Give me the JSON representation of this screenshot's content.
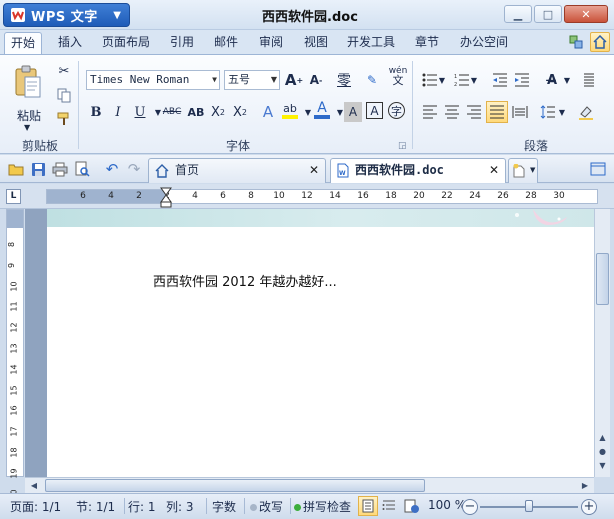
{
  "app": {
    "name": "WPS 文字",
    "document_title": "西西软件园.doc",
    "accent_color": "#2d6ac9"
  },
  "ribbon_tabs": [
    {
      "label": "开始",
      "active": true
    },
    {
      "label": "插入"
    },
    {
      "label": "页面布局"
    },
    {
      "label": "引用"
    },
    {
      "label": "邮件"
    },
    {
      "label": "审阅"
    },
    {
      "label": "视图"
    },
    {
      "label": "开发工具"
    },
    {
      "label": "章节"
    },
    {
      "label": "办公空间"
    }
  ],
  "clipboard": {
    "paste_label": "粘贴",
    "group_label": "剪贴板"
  },
  "font": {
    "family": "Times New Roman",
    "size": "五号",
    "group_label": "字体",
    "phonetic_sample": "wén"
  },
  "paragraph": {
    "group_label": "段落"
  },
  "doc_tabs": [
    {
      "label": "首页"
    },
    {
      "label": "西西软件园.doc",
      "active": true
    }
  ],
  "ruler": {
    "corner": "L",
    "h_ticks": [
      "6",
      "4",
      "2",
      "2",
      "4",
      "6",
      "8",
      "10",
      "12",
      "14",
      "16",
      "18",
      "20",
      "22",
      "24",
      "26",
      "28",
      "30"
    ],
    "v_ticks": [
      "8",
      "9",
      "10",
      "11",
      "12",
      "13",
      "14",
      "15",
      "16",
      "17",
      "18",
      "19",
      "20"
    ]
  },
  "document": {
    "text": "西西软件园 2012 年越办越好..."
  },
  "status": {
    "page": "页面: 1/1",
    "section": "节: 1/1",
    "row": "行: 1",
    "col": "列: 3",
    "word_count": "字数",
    "revise": "改写",
    "spell_check": "拼写检查",
    "zoom": "100 %",
    "zoom_level": 0.5
  }
}
